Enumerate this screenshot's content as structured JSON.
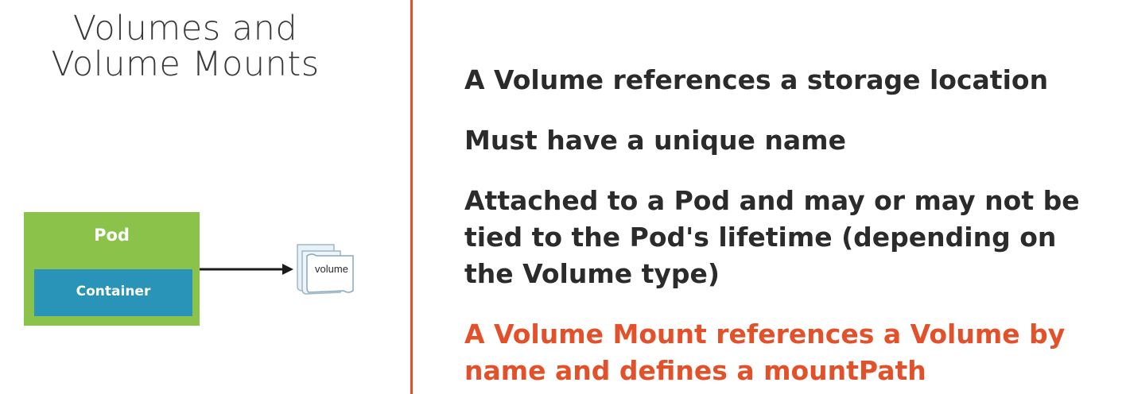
{
  "title": {
    "line1": "Volumes and",
    "line2": "Volume Mounts"
  },
  "colors": {
    "pod_green": "#8bc34a",
    "container_blue": "#2a94b8",
    "divider_orange": "#e2512a",
    "highlight_orange": "#e2512a",
    "text_dark": "#2b2b2b"
  },
  "diagram": {
    "pod_label": "Pod",
    "container_label": "Container",
    "volume_label": "volume",
    "volume_icon": "stacked-document-icon",
    "arrow_icon": "arrow-right-icon"
  },
  "points": [
    {
      "lines": [
        "A Volume references a storage location"
      ]
    },
    {
      "lines": [
        "Must have a unique name"
      ]
    },
    {
      "lines": [
        "Attached to a Pod and may or may not be",
        "tied to the Pod's lifetime (depending on",
        "the Volume type)"
      ]
    },
    {
      "lines": [
        "A Volume Mount references a Volume by",
        "name and defines a mountPath"
      ],
      "highlight": true
    }
  ]
}
